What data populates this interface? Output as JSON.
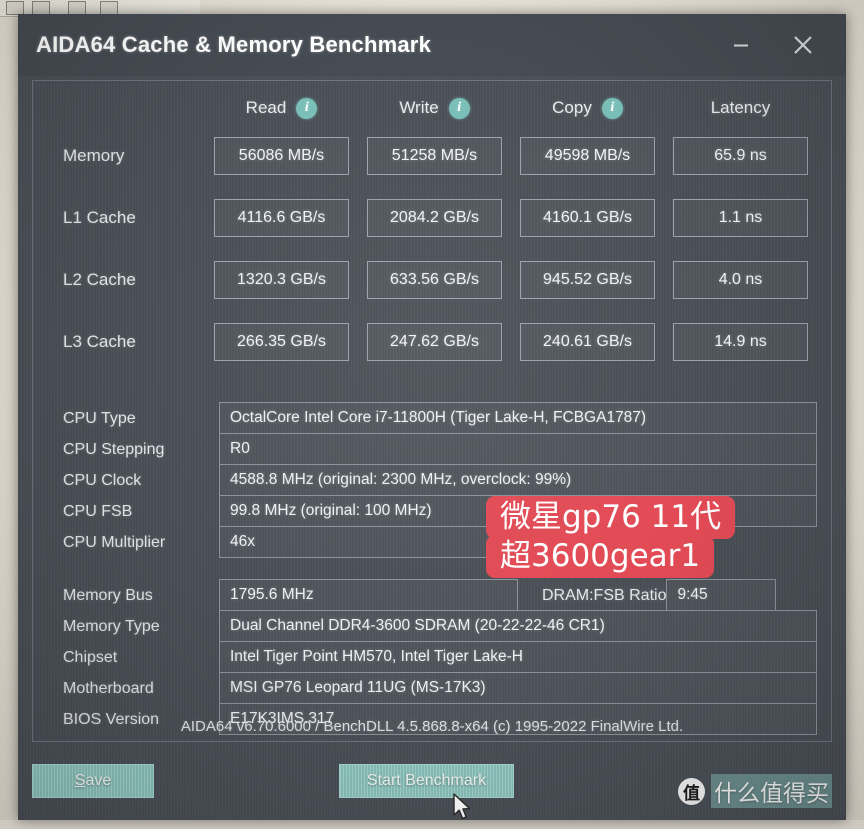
{
  "window": {
    "title": "AIDA64 Cache & Memory Benchmark",
    "minimize_label": "minimize",
    "close_label": "close"
  },
  "benchmark": {
    "columns": [
      {
        "label": "Read",
        "has_info": true
      },
      {
        "label": "Write",
        "has_info": true
      },
      {
        "label": "Copy",
        "has_info": true
      },
      {
        "label": "Latency",
        "has_info": false
      }
    ],
    "info_glyph": "i",
    "rows": [
      {
        "label": "Memory",
        "read": "56086 MB/s",
        "write": "51258 MB/s",
        "copy": "49598 MB/s",
        "latency": "65.9 ns"
      },
      {
        "label": "L1 Cache",
        "read": "4116.6 GB/s",
        "write": "2084.2 GB/s",
        "copy": "4160.1 GB/s",
        "latency": "1.1 ns"
      },
      {
        "label": "L2 Cache",
        "read": "1320.3 GB/s",
        "write": "633.56 GB/s",
        "copy": "945.52 GB/s",
        "latency": "4.0 ns"
      },
      {
        "label": "L3 Cache",
        "read": "266.35 GB/s",
        "write": "247.62 GB/s",
        "copy": "240.61 GB/s",
        "latency": "14.9 ns"
      }
    ]
  },
  "cpu_info": [
    {
      "key": "CPU Type",
      "value": "OctalCore Intel Core i7-11800H  (Tiger Lake-H, FCBGA1787)"
    },
    {
      "key": "CPU Stepping",
      "value": "R0"
    },
    {
      "key": "CPU Clock",
      "value": "4588.8 MHz  (original: 2300 MHz, overclock: 99%)"
    },
    {
      "key": "CPU FSB",
      "value": "99.8 MHz  (original: 100 MHz)"
    },
    {
      "key": "CPU Multiplier",
      "value": "46x"
    }
  ],
  "memory_info": {
    "bus_key": "Memory Bus",
    "bus_value": "1795.6 MHz",
    "ratio_key": "DRAM:FSB Ratio",
    "ratio_value": "9:45",
    "rows": [
      {
        "key": "Memory Type",
        "value": "Dual Channel DDR4-3600 SDRAM  (20-22-22-46 CR1)"
      },
      {
        "key": "Chipset",
        "value": "Intel Tiger Point HM570, Intel Tiger Lake-H"
      },
      {
        "key": "Motherboard",
        "value": "MSI GP76 Leopard 11UG (MS-17K3)"
      },
      {
        "key": "BIOS Version",
        "value": "E17K3IMS.317"
      }
    ]
  },
  "footer": {
    "version_note": "AIDA64 v6.70.6000 / BenchDLL 4.5.868.8-x64  (c) 1995-2022 FinalWire Ltd."
  },
  "buttons": {
    "save_accel": "S",
    "save_rest": "ave",
    "start_benchmark": "Start Benchmark"
  },
  "annotation": {
    "line1": "微星gp76 11代",
    "line2": "超3600gear1",
    "color": "#e24b55"
  },
  "watermark": {
    "badge": "值",
    "text": "什么值得买"
  },
  "colors": {
    "window_bg": "#4a5057",
    "titlebar_bg": "#454b52",
    "accent_teal": "#79bfb7",
    "button_teal": "#8fc9c2",
    "text": "#e9ecef"
  }
}
